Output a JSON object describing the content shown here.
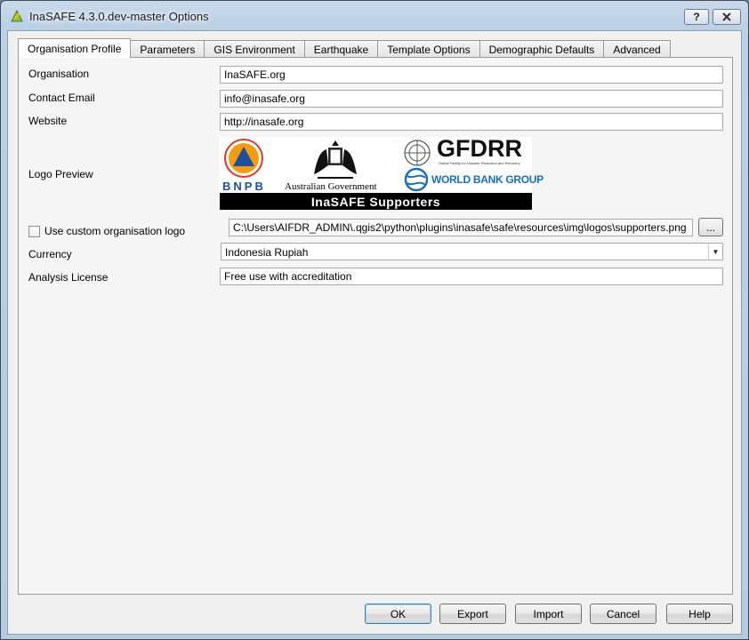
{
  "window": {
    "title": "InaSAFE 4.3.0.dev-master Options",
    "help_label": "?",
    "close_label": "X"
  },
  "tabs": [
    {
      "label": "Organisation Profile",
      "active": true
    },
    {
      "label": "Parameters"
    },
    {
      "label": "GIS Environment"
    },
    {
      "label": "Earthquake"
    },
    {
      "label": "Template Options"
    },
    {
      "label": "Demographic Defaults"
    },
    {
      "label": "Advanced"
    }
  ],
  "form": {
    "organisation_label": "Organisation",
    "organisation_value": "InaSAFE.org",
    "email_label": "Contact Email",
    "email_value": "info@inasafe.org",
    "website_label": "Website",
    "website_value": "http://inasafe.org",
    "logo_label": "Logo Preview",
    "custom_logo_label": "Use custom organisation logo",
    "custom_logo_checked": false,
    "logo_path": "C:\\Users\\AIFDR_ADMIN\\.qgis2\\python\\plugins\\inasafe\\safe\\resources\\img\\logos\\supporters.png",
    "browse_label": "...",
    "currency_label": "Currency",
    "currency_value": "Indonesia Rupiah",
    "license_label": "Analysis License",
    "license_value": "Free use with accreditation"
  },
  "logo": {
    "bnpb": "BNPB",
    "aus_gov": "Australian Government",
    "gfdrr": "GFDRR",
    "gfdrr_sub": "Global Facility for Disaster Reduction and Recovery",
    "world_bank": "WORLD BANK GROUP",
    "supporters": "InaSAFE Supporters"
  },
  "buttons": {
    "ok": "OK",
    "export": "Export",
    "import": "Import",
    "cancel": "Cancel",
    "help": "Help"
  },
  "colors": {
    "bnpb_orange": "#f39c12",
    "bnpb_blue": "#1f4e9e",
    "world_bank_blue": "#1b6fb5",
    "default_button_border": "#3c7fb1"
  }
}
